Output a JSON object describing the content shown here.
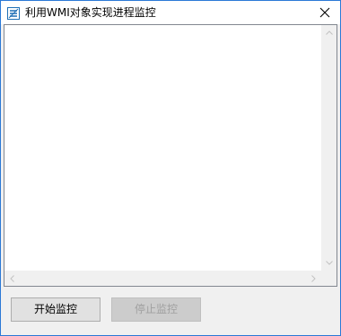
{
  "window": {
    "title": "利用WMI对象实现进程监控",
    "accent_border": "#2b79d6"
  },
  "icons": {
    "app": "app-icon",
    "close": "close-icon"
  },
  "buttons": {
    "start_label": "开始监控",
    "stop_label": "停止监控",
    "stop_disabled": true
  },
  "list": {
    "items": []
  }
}
